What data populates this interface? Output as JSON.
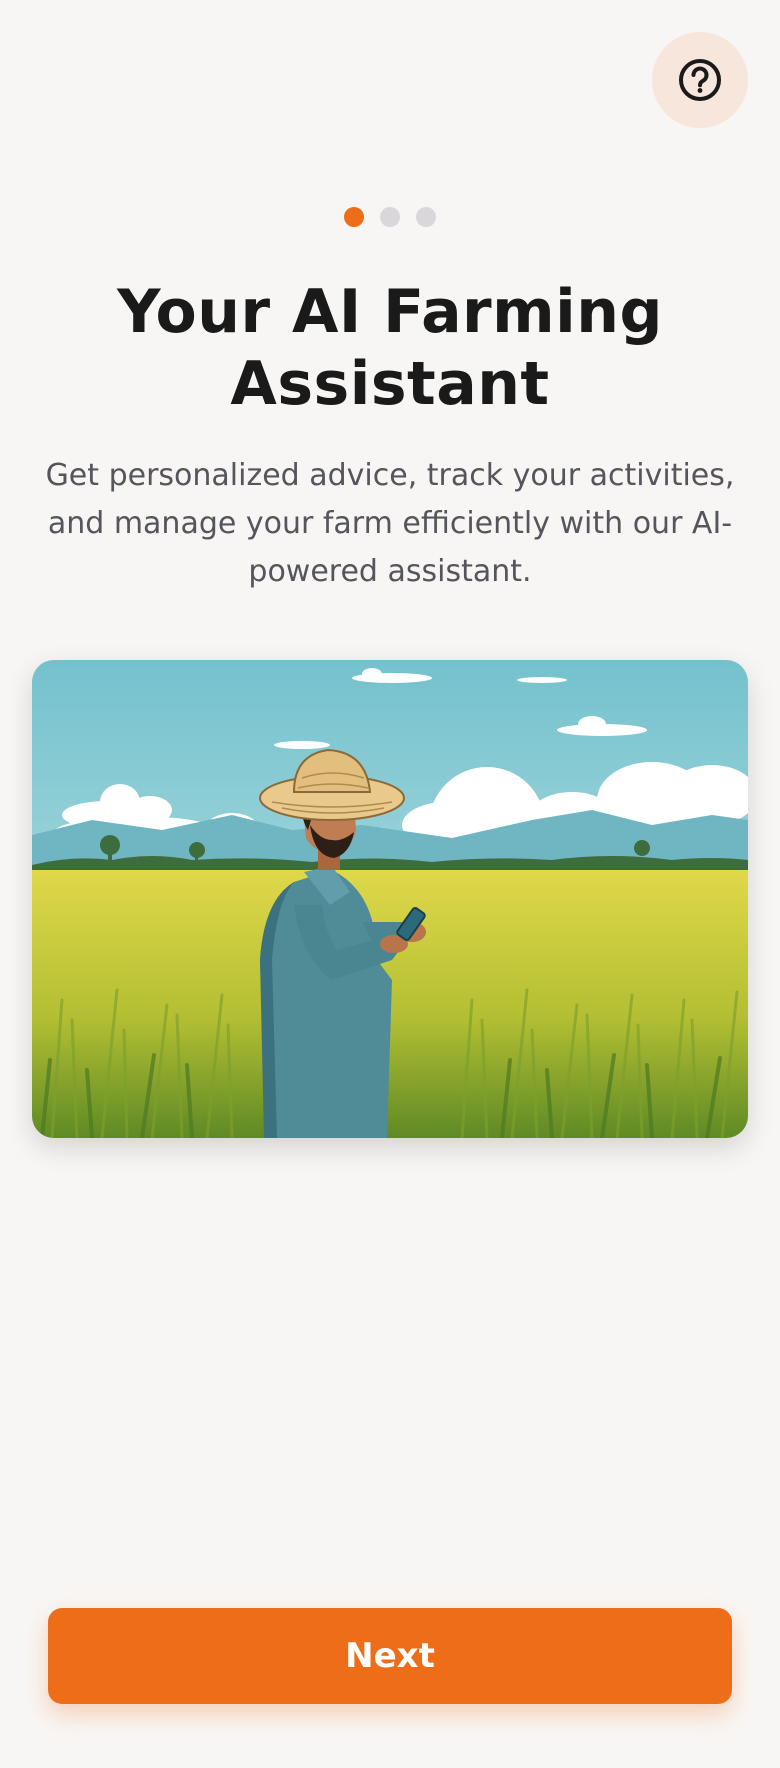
{
  "header": {
    "help_icon": "question-circle-icon"
  },
  "pagination": {
    "total": 3,
    "current": 1
  },
  "onboarding": {
    "title": "Your AI Farming Assistant",
    "subtitle": "Get personalized advice, track your activities, and manage your farm efficiently with our AI-powered assistant."
  },
  "footer": {
    "next_label": "Next"
  },
  "colors": {
    "accent": "#ed6d19",
    "background": "#f8f6f4",
    "help_bg": "#f7e6dc",
    "dot_inactive": "#d9d7da",
    "title": "#1a1a1a",
    "subtitle": "#55555b"
  }
}
